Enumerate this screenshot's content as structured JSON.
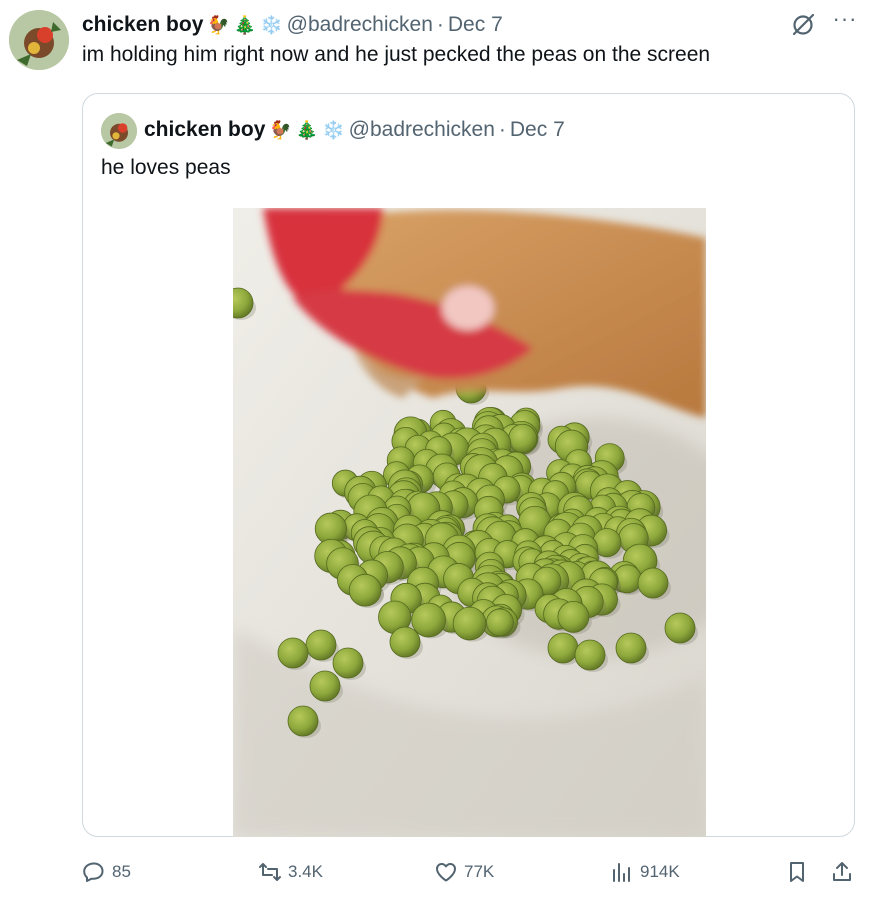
{
  "tweet": {
    "author_name": "chicken boy",
    "emojis": [
      "🐓",
      "🎄",
      "❄️"
    ],
    "handle": "@badrechicken",
    "separator": "·",
    "date": "Dec 7",
    "text": "im holding him right now and he just pecked the peas on the screen"
  },
  "quoted_tweet": {
    "author_name": "chicken boy",
    "emojis": [
      "🐓",
      "🎄",
      "❄️"
    ],
    "handle": "@badrechicken",
    "separator": "·",
    "date": "Dec 7",
    "text": "he loves peas"
  },
  "actions": {
    "replies": "85",
    "reposts": "3.4K",
    "likes": "77K",
    "views": "914K"
  },
  "icons": [
    "grok-icon",
    "more-icon",
    "reply-icon",
    "repost-icon",
    "like-icon",
    "views-icon",
    "bookmark-icon",
    "share-icon"
  ],
  "colors": {
    "text": "#0f1419",
    "secondary": "#536471",
    "border": "#cfd9de",
    "pea": "#8ea83c"
  }
}
